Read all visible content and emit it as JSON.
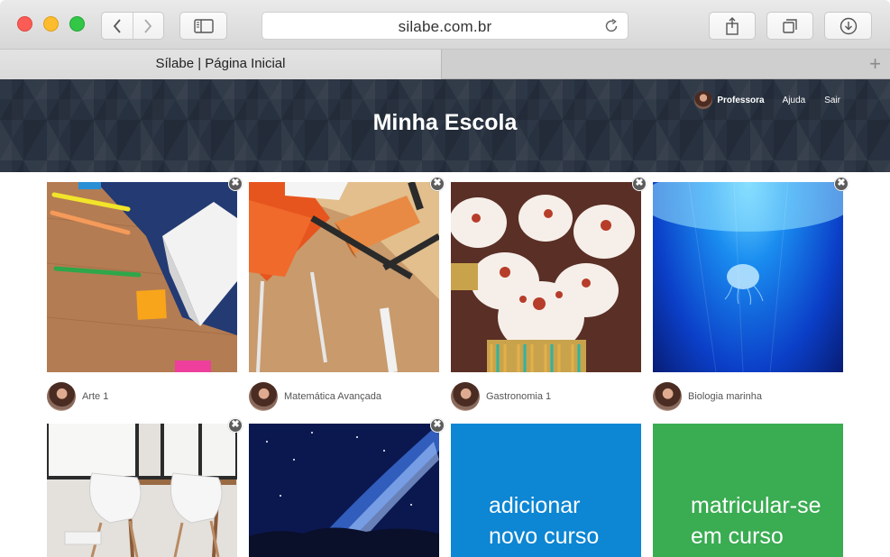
{
  "browser": {
    "url": "silabe.com.br",
    "tab_title": "Sílabe | Página Inicial",
    "new_tab_symbol": "+",
    "icons": [
      "back-icon",
      "forward-icon",
      "sidebar-icon",
      "reload-icon",
      "share-icon",
      "tabs-icon",
      "download-icon"
    ]
  },
  "header": {
    "site_title": "Minha Escola",
    "user_name": "Professora",
    "help_label": "Ajuda",
    "logout_label": "Sair",
    "background_color": "#27313f"
  },
  "courses": [
    {
      "name": "Arte 1",
      "remove_symbol": "✖"
    },
    {
      "name": "Matemática Avançada",
      "remove_symbol": "✖"
    },
    {
      "name": "Gastronomia 1",
      "remove_symbol": "✖"
    },
    {
      "name": "Biologia marinha",
      "remove_symbol": "✖"
    },
    {
      "name": "",
      "remove_symbol": "✖"
    },
    {
      "name": "",
      "remove_symbol": "✖"
    }
  ],
  "actions": {
    "add_course": {
      "line1": "adicionar",
      "line2": "novo curso",
      "color": "#0d86d3"
    },
    "enroll_course": {
      "line1": "matricular-se",
      "line2": "em curso",
      "color": "#3aac52"
    }
  }
}
